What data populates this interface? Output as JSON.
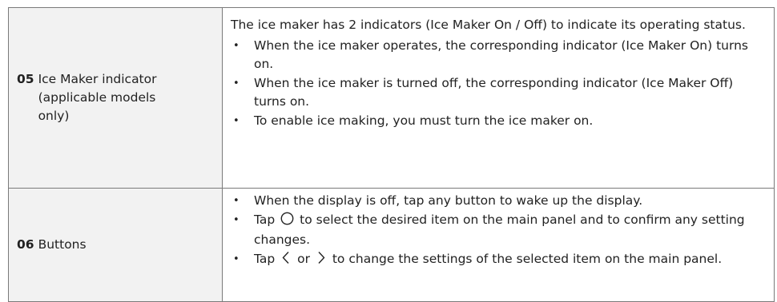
{
  "rows": [
    {
      "num": "05",
      "label": "Ice Maker indicator (applicable models only)",
      "intro": "The ice maker has 2 indicators (Ice Maker On / Off) to indicate its operating status.",
      "bullets": [
        "When the ice maker operates, the corresponding indicator (Ice Maker On) turns on.",
        "When the ice maker is turned off, the corresponding indicator (Ice Maker Off) turns on.",
        "To enable ice making, you must turn the ice maker on."
      ]
    },
    {
      "num": "06",
      "label": "Buttons",
      "bullets": [
        {
          "text": "When the display is off, tap any button to wake up the display."
        },
        {
          "pre": "Tap",
          "icon": "circle-icon",
          "post": "to select the desired item on the main panel and to confirm any setting changes."
        },
        {
          "pre": "Tap",
          "icon1": "chevron-left-icon",
          "mid": "or",
          "icon2": "chevron-right-icon",
          "post": "to change the settings of the selected item on the main panel."
        }
      ]
    }
  ],
  "bullet_glyph": "•"
}
